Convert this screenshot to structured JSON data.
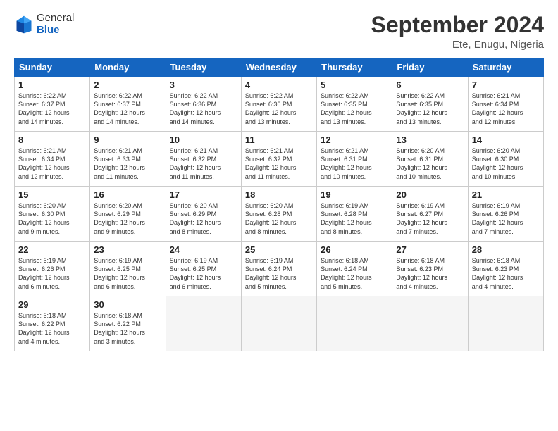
{
  "header": {
    "logo_general": "General",
    "logo_blue": "Blue",
    "month_title": "September 2024",
    "location": "Ete, Enugu, Nigeria"
  },
  "days_header": [
    "Sunday",
    "Monday",
    "Tuesday",
    "Wednesday",
    "Thursday",
    "Friday",
    "Saturday"
  ],
  "weeks": [
    [
      {
        "day": "1",
        "lines": [
          "Sunrise: 6:22 AM",
          "Sunset: 6:37 PM",
          "Daylight: 12 hours",
          "and 14 minutes."
        ]
      },
      {
        "day": "2",
        "lines": [
          "Sunrise: 6:22 AM",
          "Sunset: 6:37 PM",
          "Daylight: 12 hours",
          "and 14 minutes."
        ]
      },
      {
        "day": "3",
        "lines": [
          "Sunrise: 6:22 AM",
          "Sunset: 6:36 PM",
          "Daylight: 12 hours",
          "and 14 minutes."
        ]
      },
      {
        "day": "4",
        "lines": [
          "Sunrise: 6:22 AM",
          "Sunset: 6:36 PM",
          "Daylight: 12 hours",
          "and 13 minutes."
        ]
      },
      {
        "day": "5",
        "lines": [
          "Sunrise: 6:22 AM",
          "Sunset: 6:35 PM",
          "Daylight: 12 hours",
          "and 13 minutes."
        ]
      },
      {
        "day": "6",
        "lines": [
          "Sunrise: 6:22 AM",
          "Sunset: 6:35 PM",
          "Daylight: 12 hours",
          "and 13 minutes."
        ]
      },
      {
        "day": "7",
        "lines": [
          "Sunrise: 6:21 AM",
          "Sunset: 6:34 PM",
          "Daylight: 12 hours",
          "and 12 minutes."
        ]
      }
    ],
    [
      {
        "day": "8",
        "lines": [
          "Sunrise: 6:21 AM",
          "Sunset: 6:34 PM",
          "Daylight: 12 hours",
          "and 12 minutes."
        ]
      },
      {
        "day": "9",
        "lines": [
          "Sunrise: 6:21 AM",
          "Sunset: 6:33 PM",
          "Daylight: 12 hours",
          "and 11 minutes."
        ]
      },
      {
        "day": "10",
        "lines": [
          "Sunrise: 6:21 AM",
          "Sunset: 6:32 PM",
          "Daylight: 12 hours",
          "and 11 minutes."
        ]
      },
      {
        "day": "11",
        "lines": [
          "Sunrise: 6:21 AM",
          "Sunset: 6:32 PM",
          "Daylight: 12 hours",
          "and 11 minutes."
        ]
      },
      {
        "day": "12",
        "lines": [
          "Sunrise: 6:21 AM",
          "Sunset: 6:31 PM",
          "Daylight: 12 hours",
          "and 10 minutes."
        ]
      },
      {
        "day": "13",
        "lines": [
          "Sunrise: 6:20 AM",
          "Sunset: 6:31 PM",
          "Daylight: 12 hours",
          "and 10 minutes."
        ]
      },
      {
        "day": "14",
        "lines": [
          "Sunrise: 6:20 AM",
          "Sunset: 6:30 PM",
          "Daylight: 12 hours",
          "and 10 minutes."
        ]
      }
    ],
    [
      {
        "day": "15",
        "lines": [
          "Sunrise: 6:20 AM",
          "Sunset: 6:30 PM",
          "Daylight: 12 hours",
          "and 9 minutes."
        ]
      },
      {
        "day": "16",
        "lines": [
          "Sunrise: 6:20 AM",
          "Sunset: 6:29 PM",
          "Daylight: 12 hours",
          "and 9 minutes."
        ]
      },
      {
        "day": "17",
        "lines": [
          "Sunrise: 6:20 AM",
          "Sunset: 6:29 PM",
          "Daylight: 12 hours",
          "and 8 minutes."
        ]
      },
      {
        "day": "18",
        "lines": [
          "Sunrise: 6:20 AM",
          "Sunset: 6:28 PM",
          "Daylight: 12 hours",
          "and 8 minutes."
        ]
      },
      {
        "day": "19",
        "lines": [
          "Sunrise: 6:19 AM",
          "Sunset: 6:28 PM",
          "Daylight: 12 hours",
          "and 8 minutes."
        ]
      },
      {
        "day": "20",
        "lines": [
          "Sunrise: 6:19 AM",
          "Sunset: 6:27 PM",
          "Daylight: 12 hours",
          "and 7 minutes."
        ]
      },
      {
        "day": "21",
        "lines": [
          "Sunrise: 6:19 AM",
          "Sunset: 6:26 PM",
          "Daylight: 12 hours",
          "and 7 minutes."
        ]
      }
    ],
    [
      {
        "day": "22",
        "lines": [
          "Sunrise: 6:19 AM",
          "Sunset: 6:26 PM",
          "Daylight: 12 hours",
          "and 6 minutes."
        ]
      },
      {
        "day": "23",
        "lines": [
          "Sunrise: 6:19 AM",
          "Sunset: 6:25 PM",
          "Daylight: 12 hours",
          "and 6 minutes."
        ]
      },
      {
        "day": "24",
        "lines": [
          "Sunrise: 6:19 AM",
          "Sunset: 6:25 PM",
          "Daylight: 12 hours",
          "and 6 minutes."
        ]
      },
      {
        "day": "25",
        "lines": [
          "Sunrise: 6:19 AM",
          "Sunset: 6:24 PM",
          "Daylight: 12 hours",
          "and 5 minutes."
        ]
      },
      {
        "day": "26",
        "lines": [
          "Sunrise: 6:18 AM",
          "Sunset: 6:24 PM",
          "Daylight: 12 hours",
          "and 5 minutes."
        ]
      },
      {
        "day": "27",
        "lines": [
          "Sunrise: 6:18 AM",
          "Sunset: 6:23 PM",
          "Daylight: 12 hours",
          "and 4 minutes."
        ]
      },
      {
        "day": "28",
        "lines": [
          "Sunrise: 6:18 AM",
          "Sunset: 6:23 PM",
          "Daylight: 12 hours",
          "and 4 minutes."
        ]
      }
    ],
    [
      {
        "day": "29",
        "lines": [
          "Sunrise: 6:18 AM",
          "Sunset: 6:22 PM",
          "Daylight: 12 hours",
          "and 4 minutes."
        ]
      },
      {
        "day": "30",
        "lines": [
          "Sunrise: 6:18 AM",
          "Sunset: 6:22 PM",
          "Daylight: 12 hours",
          "and 3 minutes."
        ]
      },
      {
        "day": "",
        "lines": []
      },
      {
        "day": "",
        "lines": []
      },
      {
        "day": "",
        "lines": []
      },
      {
        "day": "",
        "lines": []
      },
      {
        "day": "",
        "lines": []
      }
    ]
  ]
}
